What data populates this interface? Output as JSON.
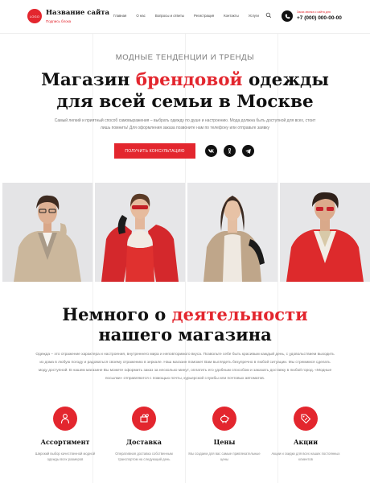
{
  "header": {
    "logo_text": "LOGO",
    "site_name": "Название сайта",
    "site_subtitle": "Подпись блока",
    "nav": [
      "Главная",
      "О нас",
      "Вопросы и ответы",
      "Регистрация",
      "Контакты",
      "Услуги"
    ],
    "callback_label": "Заказ звонка с сайта для",
    "phone": "+7 (000) 000-00-00"
  },
  "hero": {
    "kicker": "МОДНЫЕ ТЕНДЕНЦИИ И ТРЕНДЫ",
    "title_part1": "Магазин ",
    "title_accent": "брендовой",
    "title_part2": " одежды",
    "title_line2": "для всей семьи в Москве",
    "text": "Самый легкий и приятный способ самовыражения – выбрать одежду по душе и настроению. Мода должна быть доступной для всех, стоит лишь помнить! Для оформления заказа позвоните нам по телефону или отправьте заявку",
    "cta_label": "ПОЛУЧИТЬ КОНСУЛЬТАЦИЮ",
    "social_icons": [
      "vk-icon",
      "odnoklassniki-icon",
      "telegram-icon"
    ]
  },
  "about": {
    "title_part1": "Немного о ",
    "title_accent": "деятельности",
    "title_line2": "нашего магазина",
    "text": "Одежда – это отражение характера и настроения, внутреннего мира и неповторимого вкуса. Позвольте себе быть красивым каждый день, с удовольствием выходить из дома в любую погоду и радоваться своему отражению в зеркале. Наш магазин поможет Вам выглядеть безупречно в любой ситуации. Мы стремимся сделать моду доступной. В нашем магазине Вы можете оформить заказ за несколько минут, оплатить его удобным способом и заказать доставку в любой город. «Модные посылки» отправляются с помощью почты, курьерской службы или почтовых автоматов."
  },
  "features": [
    {
      "title": "Ассортимент",
      "text": "Широкий выбор качественной модной одежды всех размеров",
      "icon": "person-icon"
    },
    {
      "title": "Доставка",
      "text": "Оперативная доставка собственным транспортом на следующий день",
      "icon": "delivery-icon"
    },
    {
      "title": "Цены",
      "text": "Мы создаем для вас самые привлекательные цены",
      "icon": "piggy-bank-icon"
    },
    {
      "title": "Акции",
      "text": "Акции и скидки для всех наших постоянных клиентов",
      "icon": "percent-tag-icon"
    }
  ],
  "colors": {
    "accent": "#e3262e",
    "dark": "#111111"
  }
}
